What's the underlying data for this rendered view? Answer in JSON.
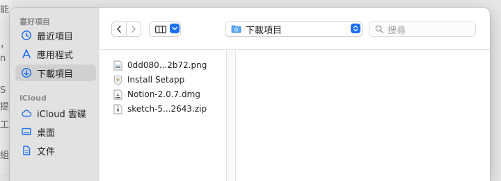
{
  "background_app": {
    "chars": [
      "能",
      "，",
      "n",
      "S",
      "提",
      "工",
      "組"
    ]
  },
  "sidebar": {
    "favorites_title": "喜好項目",
    "favorites": [
      {
        "label": "最近項目",
        "icon": "clock-icon"
      },
      {
        "label": "應用程式",
        "icon": "applications-icon"
      },
      {
        "label": "下載項目",
        "icon": "download-icon",
        "selected": true
      }
    ],
    "icloud_title": "iCloud",
    "icloud": [
      {
        "label": "iCloud 雲碟",
        "icon": "cloud-icon"
      },
      {
        "label": "桌面",
        "icon": "desktop-icon"
      },
      {
        "label": "文件",
        "icon": "document-icon"
      }
    ]
  },
  "toolbar": {
    "location": "下載項目",
    "search_placeholder": "搜尋",
    "view_mode": "columns-icon"
  },
  "files": [
    {
      "name": "0dd080...2b72.png",
      "icon": "image-file-icon"
    },
    {
      "name": "Install Setapp",
      "icon": "installer-icon"
    },
    {
      "name": "Notion-2.0.7.dmg",
      "icon": "disk-image-icon"
    },
    {
      "name": "sketch-5...2643.zip",
      "icon": "zip-file-icon"
    }
  ],
  "colors": {
    "accent": "#1a6ff5",
    "sidebar_bg": "#e2e2e2",
    "selected_bg": "#d0d0d0"
  }
}
